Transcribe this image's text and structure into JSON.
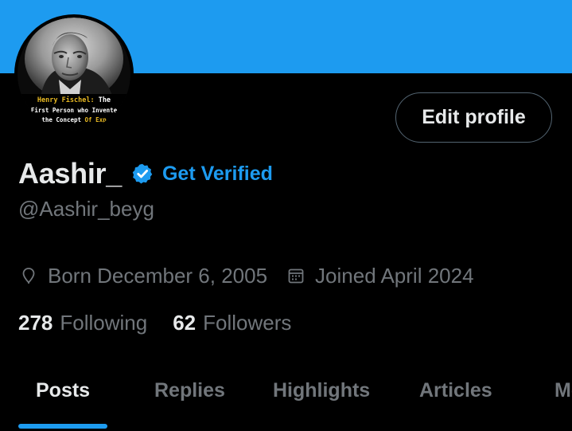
{
  "colors": {
    "banner": "#1d9bf0",
    "accent": "#1d9bf0",
    "text_primary": "#e7e9ea",
    "text_secondary": "#71767b",
    "background": "#000000",
    "border": "#536471"
  },
  "avatar": {
    "caption_line1_a": "Henry Fischel:",
    "caption_line1_b": " The",
    "caption_line2": "First Person who Invente",
    "caption_line3_a": "the Concept ",
    "caption_line3_b": "Of Exp"
  },
  "profile": {
    "edit_button_label": "Edit profile",
    "display_name": "Aashir_",
    "verified_icon": "verified-badge-icon",
    "get_verified_label": "Get Verified",
    "handle": "@Aashir_beyg",
    "born_icon": "location-pin-icon",
    "born": "Born December 6, 2005",
    "joined_icon": "calendar-icon",
    "joined": "Joined April 2024"
  },
  "stats": {
    "following_count": "278",
    "following_label": "Following",
    "followers_count": "62",
    "followers_label": "Followers"
  },
  "tabs": [
    {
      "label": "Posts",
      "active": true
    },
    {
      "label": "Replies",
      "active": false
    },
    {
      "label": "Highlights",
      "active": false
    },
    {
      "label": "Articles",
      "active": false
    },
    {
      "label": "Media",
      "active": false
    }
  ]
}
